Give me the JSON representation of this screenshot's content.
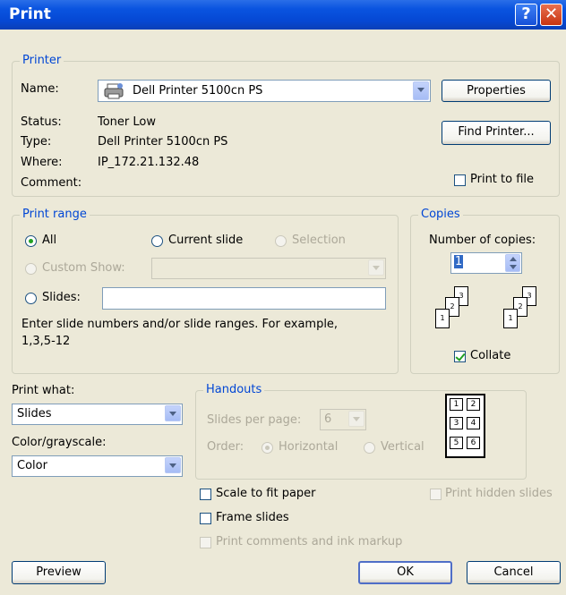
{
  "window": {
    "title": "Print",
    "help_glyph": "?",
    "close_glyph": "✕"
  },
  "printer": {
    "legend": "Printer",
    "name_label": "Name:",
    "name_value": "Dell Printer 5100cn PS",
    "status_label": "Status:",
    "status_value": "Toner Low",
    "type_label": "Type:",
    "type_value": "Dell Printer 5100cn PS",
    "where_label": "Where:",
    "where_value": "IP_172.21.132.48",
    "comment_label": "Comment:",
    "comment_value": "",
    "properties_button": "Properties",
    "find_printer_button": "Find Printer...",
    "print_to_file_label": "Print to file",
    "print_to_file_checked": false
  },
  "print_range": {
    "legend": "Print range",
    "all_label": "All",
    "all_selected": true,
    "current_slide_label": "Current slide",
    "selection_label": "Selection",
    "custom_show_label": "Custom Show:",
    "custom_show_value": "",
    "slides_label": "Slides:",
    "slides_value": "",
    "help_text_line1": "Enter slide numbers and/or slide ranges. For example,",
    "help_text_line2": "1,3,5-12"
  },
  "copies": {
    "legend": "Copies",
    "number_label": "Number of copies:",
    "number_value": "1",
    "collate_label": "Collate",
    "collate_checked": true,
    "page_numbers": [
      "1",
      "2",
      "3"
    ]
  },
  "print_what": {
    "label": "Print what:",
    "value": "Slides"
  },
  "color": {
    "label": "Color/grayscale:",
    "value": "Color"
  },
  "handouts": {
    "legend": "Handouts",
    "per_page_label": "Slides per page:",
    "per_page_value": "6",
    "order_label": "Order:",
    "horizontal_label": "Horizontal",
    "horizontal_selected": true,
    "vertical_label": "Vertical",
    "preview_numbers": [
      "1",
      "2",
      "3",
      "4",
      "5",
      "6"
    ]
  },
  "options": {
    "scale_label": "Scale to fit paper",
    "scale_checked": false,
    "frame_label": "Frame slides",
    "frame_checked": false,
    "comments_label": "Print comments and ink markup",
    "hidden_label": "Print hidden slides"
  },
  "buttons": {
    "preview": "Preview",
    "ok": "OK",
    "cancel": "Cancel"
  }
}
